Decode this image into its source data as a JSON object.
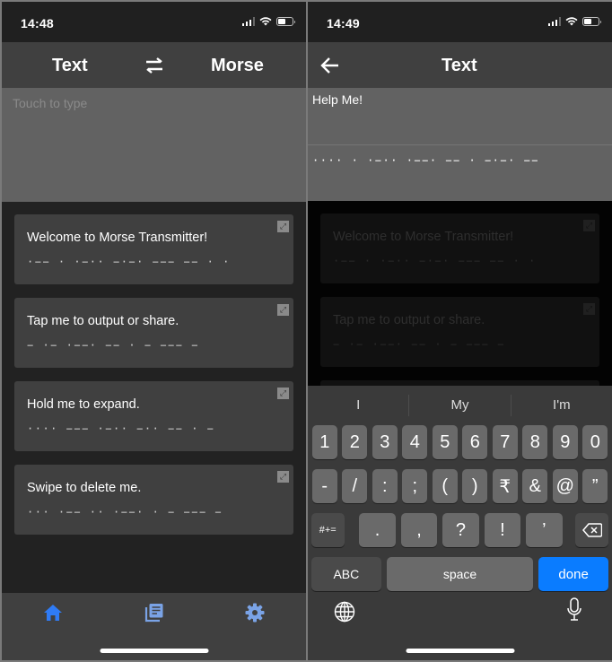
{
  "left": {
    "status": {
      "time": "14:48"
    },
    "nav": {
      "left_label": "Text",
      "swap_icon": "swap-arrows-icon",
      "right_label": "Morse"
    },
    "input": {
      "placeholder": "Touch to type"
    },
    "cards": [
      {
        "title": "Welcome to Morse Transmitter!",
        "morse": "·−− · ·−·· −·−· −−− −− ·   ·"
      },
      {
        "title": "Tap me to output or share.",
        "morse": "− ·− ·−−·   −− ·   − −−−   −"
      },
      {
        "title": "Hold me to expand.",
        "morse": "···· −−− ·−·· −··   −− ·   −"
      },
      {
        "title": "Swipe to delete me.",
        "morse": "··· ·−− ·· ·−−· ·   − −−−   −"
      }
    ],
    "tabs": [
      {
        "name": "home",
        "icon": "home-icon",
        "color": "#2f7bf5"
      },
      {
        "name": "library",
        "icon": "library-icon",
        "color": "#7aa3e6"
      },
      {
        "name": "settings",
        "icon": "gear-icon",
        "color": "#7aa3e6"
      }
    ]
  },
  "right": {
    "status": {
      "time": "14:49"
    },
    "nav": {
      "back_icon": "back-arrow-icon",
      "title": "Text"
    },
    "input": {
      "value": "Help Me!"
    },
    "output": {
      "morse": "···· · ·−·· ·−−·   −− · −·−· −−"
    },
    "keyboard": {
      "suggestions": [
        "I",
        "My",
        "I'm"
      ],
      "row1": [
        "1",
        "2",
        "3",
        "4",
        "5",
        "6",
        "7",
        "8",
        "9",
        "0"
      ],
      "row2": [
        "-",
        "/",
        ":",
        ";",
        "(",
        ")",
        "₹",
        "&",
        "@",
        "”"
      ],
      "row3": {
        "mode": "#+=",
        "keys": [
          ".",
          ",",
          "?",
          "!",
          "’"
        ],
        "delete_icon": "backspace-icon"
      },
      "row4": {
        "abc": "ABC",
        "space": "space",
        "done": "done"
      },
      "globe_icon": "globe-icon",
      "mic_icon": "microphone-icon"
    }
  }
}
